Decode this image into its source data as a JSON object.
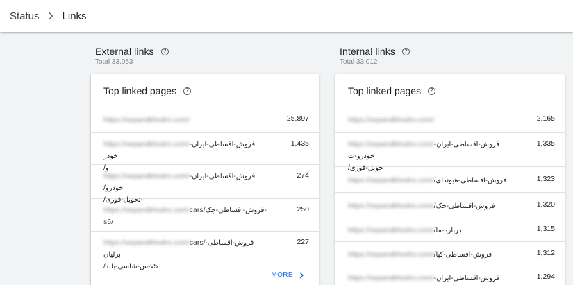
{
  "breadcrumb": {
    "status": "Status",
    "current": "Links"
  },
  "external": {
    "title": "External links",
    "total": "Total 33,053",
    "card_title": "Top linked pages",
    "more_label": "MORE",
    "rows": [
      {
        "url": "https://sepandkhodro.com/",
        "path": "",
        "count": "25,897"
      },
      {
        "url": "https://sepandkhodro.com/",
        "path": "فروش-اقساطی-ایران-خودر",
        "path2": "و/",
        "count": "1,435"
      },
      {
        "url": "https://sepandkhodro.com/",
        "path": "فروش-اقساطی-ایران-خودرو/",
        "path2": "-تحویل-فوری/",
        "count": "274"
      },
      {
        "url": "https://sepandkhodro.com/",
        "plain": "cars/",
        "path": "-فروش-اقساطی-جک",
        "path2": "s5/",
        "count": "250"
      },
      {
        "url": "https://sepandkhodro.com/",
        "plain": "cars/",
        "path": "فروش-اقساطی-برلیان",
        "path2": "v5-س-شاسی-بلند/",
        "count": "227"
      }
    ]
  },
  "internal": {
    "title": "Internal links",
    "total": "Total 33,012",
    "card_title": "Top linked pages",
    "rows": [
      {
        "url": "https://sepandkhodro.com/",
        "path": "",
        "count": "2,165"
      },
      {
        "url": "https://sepandkhodro.com/",
        "path": "فروش-اقساطی-ایران-خودرو-ت",
        "path2": "حویل-فوری/",
        "count": "1,335"
      },
      {
        "url": "https://sepandkhodro.com/",
        "path": "فروش-اقساطی-هیوندای/",
        "count": "1,323"
      },
      {
        "url": "https://sepandkhodro.com/",
        "path": "فروش-اقساطی-جک/",
        "count": "1,320"
      },
      {
        "url": "https://sepandkhodro.com/",
        "path": "درباره-ما/",
        "count": "1,315"
      },
      {
        "url": "https://sepandkhodro.com/",
        "path": "فروش-اقساطی-کیا/",
        "count": "1,312"
      },
      {
        "url": "https://sepandkhodro.com/",
        "path": "فروش-اقساطی-ایران-خودرو/",
        "count": "1,294"
      }
    ]
  }
}
